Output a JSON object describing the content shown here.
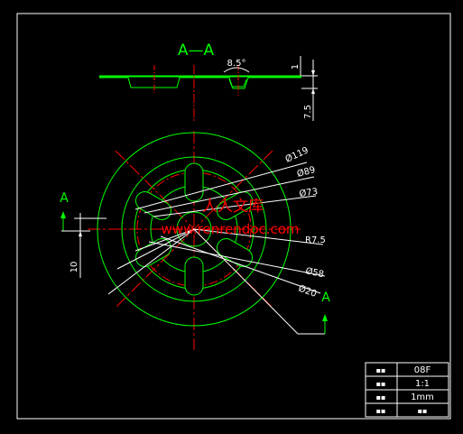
{
  "section_title": "A—A",
  "section_markers": {
    "left": "A",
    "right": "A"
  },
  "dimensions": {
    "angle": "8.5°",
    "thickness": "1",
    "height": "7.5",
    "offset": "10",
    "d119": "Ø119",
    "d89": "Ø89",
    "d73": "Ø73",
    "r75": "R7.5",
    "d58": "Ø58",
    "d20": "Ø20"
  },
  "watermark": {
    "cn": "人人文库",
    "url": "www.renrendoc.com"
  },
  "title_block": {
    "rows": [
      {
        "label": "▪▪",
        "value": "08F"
      },
      {
        "label": "▪▪",
        "value": "1:1"
      },
      {
        "label": "▪▪",
        "value": "1mm"
      },
      {
        "label": "▪▪",
        "value": "▪▪"
      }
    ]
  },
  "colors": {
    "background": "#000000",
    "border": "#ffffff",
    "outline": "#00ff00",
    "centerline": "#ff0000",
    "dimension": "#ffffff",
    "section_label": "#00ff00",
    "watermark": "#ff0000"
  }
}
